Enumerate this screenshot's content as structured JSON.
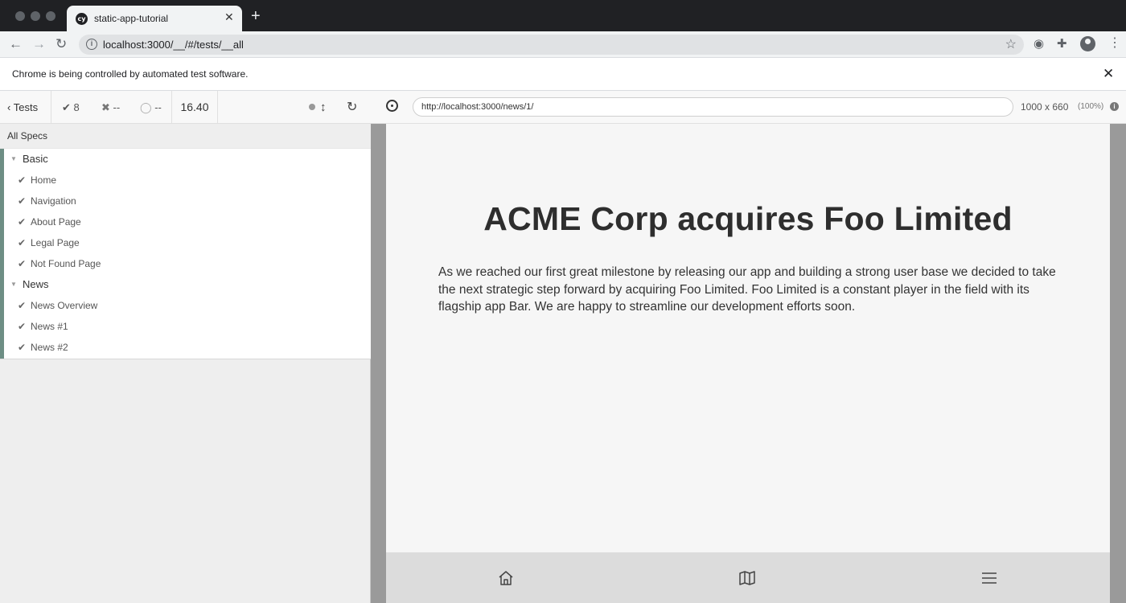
{
  "browser": {
    "tab_title": "static-app-tutorial",
    "tab_favicon": "cy",
    "url": "localhost:3000/__/#/tests/__all",
    "infobar_text": "Chrome is being controlled by automated test software."
  },
  "reporter": {
    "back_label": "Tests",
    "passed_count": "8",
    "failed_count": "--",
    "pending_count": "--",
    "duration": "16.40",
    "all_specs_label": "All Specs",
    "suites": [
      {
        "name": "Basic",
        "tests": [
          "Home",
          "Navigation",
          "About Page",
          "Legal Page",
          "Not Found Page"
        ]
      },
      {
        "name": "News",
        "tests": [
          "News Overview",
          "News #1",
          "News #2"
        ]
      }
    ]
  },
  "aut": {
    "url": "http://localhost:3000/news/1/",
    "viewport_size": "1000 x 660",
    "scale": "(100%)"
  },
  "page": {
    "title": "ACME Corp acquires Foo Limited",
    "body": "As we reached our first great milestone by releasing our app and building a strong user base we decided to take the next strategic step forward by acquiring Foo Limited. Foo Limited is a constant player in the field with its flagship app Bar. We are happy to streamline our development efforts soon.",
    "bottom_nav": [
      "home-icon",
      "book-icon",
      "menu-icon"
    ]
  },
  "colors": {
    "chrome_dark": "#202124",
    "reporter_pass_bar": "#6d8e84",
    "viewport_bg": "#f6f6f6",
    "bottom_nav_bg": "#dcdcdc"
  }
}
